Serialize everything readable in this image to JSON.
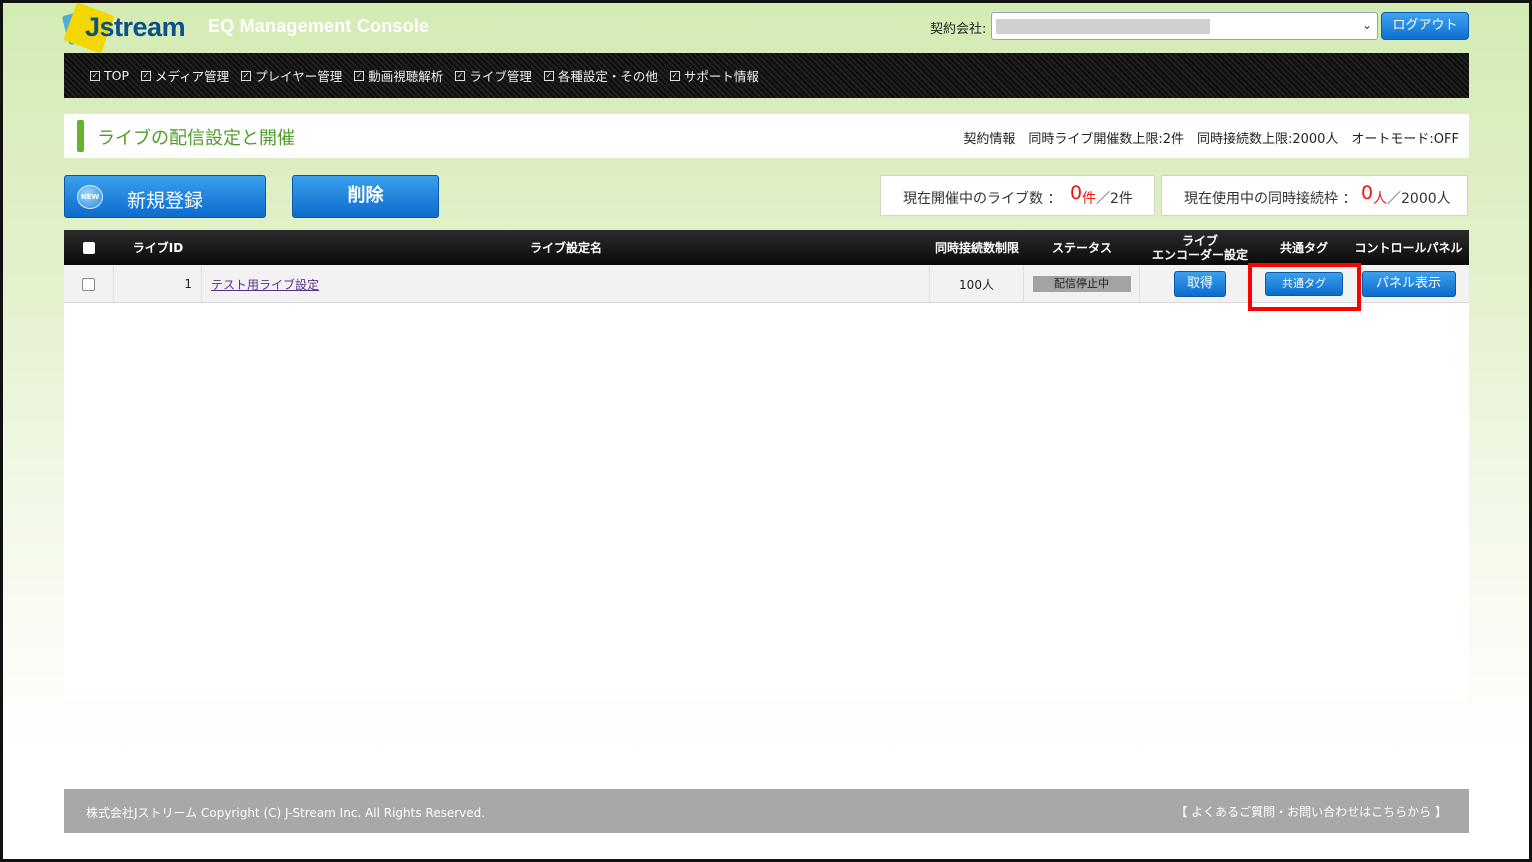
{
  "header": {
    "logo_text": "Jstream",
    "app_title": "EQ Management Console",
    "contract_label": "契約会社:",
    "logout_label": "ログアウト"
  },
  "nav": {
    "items": [
      {
        "label": "TOP"
      },
      {
        "label": "メディア管理"
      },
      {
        "label": "プレイヤー管理"
      },
      {
        "label": "動画視聴解析"
      },
      {
        "label": "ライブ管理"
      },
      {
        "label": "各種設定・その他"
      },
      {
        "label": "サポート情報"
      }
    ]
  },
  "page": {
    "title": "ライブの配信設定と開催",
    "contract_info": "契約情報　同時ライブ開催数上限:2件　同時接続数上限:2000人　オートモード:OFF"
  },
  "actions": {
    "new_icon_text": "NEW",
    "new_label": "新規登録",
    "delete_label": "削除"
  },
  "stats": {
    "live_label": "現在開催中のライブ数 ：",
    "live_count": "0",
    "live_unit": "件",
    "live_limit": "／2件",
    "conn_label": "現在使用中の同時接続枠 ：",
    "conn_count": "0",
    "conn_unit": "人",
    "conn_limit": "／2000人"
  },
  "table": {
    "headers": {
      "id": "ライブID",
      "name": "ライブ設定名",
      "limit": "同時接続数制限",
      "status": "ステータス",
      "encoder_line1": "ライブ",
      "encoder_line2": "エンコーダー設定",
      "tag": "共通タグ",
      "panel": "コントロールパネル"
    },
    "rows": [
      {
        "id": "1",
        "name": "テスト用ライブ設定",
        "limit": "100人",
        "status": "配信停止中",
        "encoder_button": "取得",
        "tag_button": "共通タグ",
        "panel_button": "パネル表示"
      }
    ]
  },
  "footer": {
    "copyright": "株式会社Jストリーム  Copyright (C) J-Stream Inc. All Rights Reserved.",
    "faq": "【 よくあるご質問・お問い合わせはこちらから 】"
  },
  "colors": {
    "accent_blue": "#1a7fd9",
    "title_green": "#4f9d28",
    "highlight_red": "#ff0000",
    "count_red": "#f01414"
  }
}
